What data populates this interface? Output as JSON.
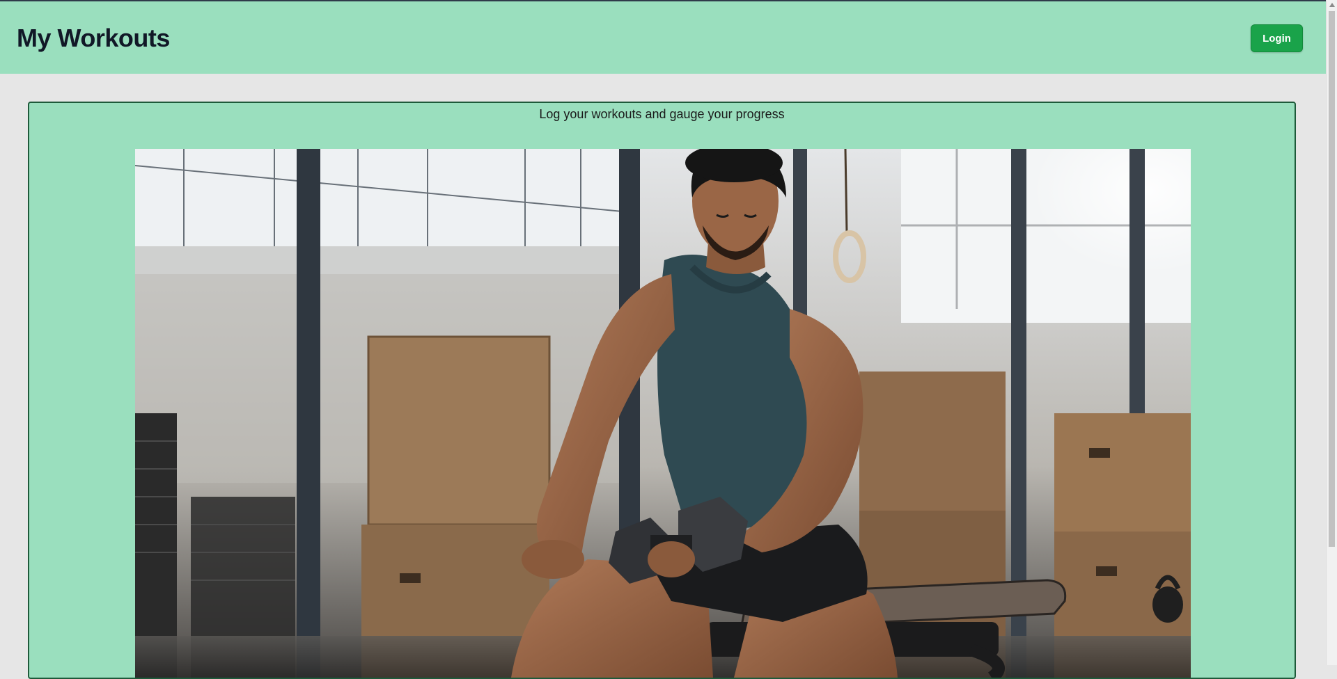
{
  "header": {
    "title": "My Workouts",
    "login_label": "Login"
  },
  "hero": {
    "tagline": "Log your workouts and gauge your progress",
    "image_alt": "Man doing dumbbell curls seated on a bench in a gym"
  },
  "colors": {
    "header_bg": "#9adfbe",
    "page_bg": "#e6e6e6",
    "button_bg": "#1aa34a",
    "card_border": "#1e5a3a"
  },
  "icons": {
    "scroll_up": "triangle-up-icon"
  }
}
